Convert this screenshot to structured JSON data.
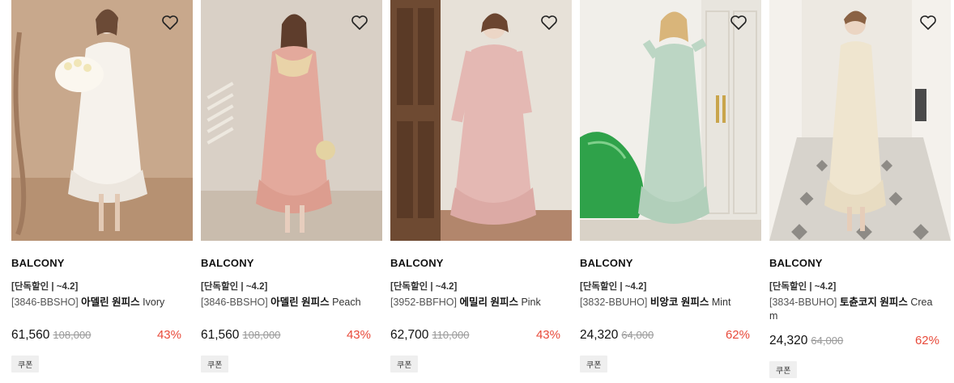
{
  "products": [
    {
      "brand": "BALCONY",
      "tag": "[단독할인 | ~4.2]",
      "code": "[3846-BBSHO]",
      "title": "아델린 원피스",
      "color": "Ivory",
      "price": "61,560",
      "original_price": "108,000",
      "discount": "43%",
      "badge": "쿠폰",
      "icon": "heart-outline-icon"
    },
    {
      "brand": "BALCONY",
      "tag": "[단독할인 | ~4.2]",
      "code": "[3846-BBSHO]",
      "title": "아델린 원피스",
      "color": "Peach",
      "price": "61,560",
      "original_price": "108,000",
      "discount": "43%",
      "badge": "쿠폰",
      "icon": "heart-outline-icon"
    },
    {
      "brand": "BALCONY",
      "tag": "[단독할인 | ~4.2]",
      "code": "[3952-BBFHO]",
      "title": "에밀리 원피스",
      "color": "Pink",
      "price": "62,700",
      "original_price": "110,000",
      "discount": "43%",
      "badge": "쿠폰",
      "icon": "heart-outline-icon"
    },
    {
      "brand": "BALCONY",
      "tag": "[단독할인 | ~4.2]",
      "code": "[3832-BBUHO]",
      "title": "비앙코 원피스",
      "color": "Mint",
      "price": "24,320",
      "original_price": "64,000",
      "discount": "62%",
      "badge": "쿠폰",
      "icon": "heart-outline-icon"
    },
    {
      "brand": "BALCONY",
      "tag": "[단독할인 | ~4.2]",
      "code": "[3834-BBUHO]",
      "title": "토츈코지 원피스",
      "color": "Cream",
      "price": "24,320",
      "original_price": "64,000",
      "discount": "62%",
      "badge": "쿠폰",
      "icon": "heart-outline-icon"
    }
  ],
  "colors": {
    "discount": "#e84a3a",
    "strike": "#999999",
    "badge_bg": "#efefef"
  }
}
